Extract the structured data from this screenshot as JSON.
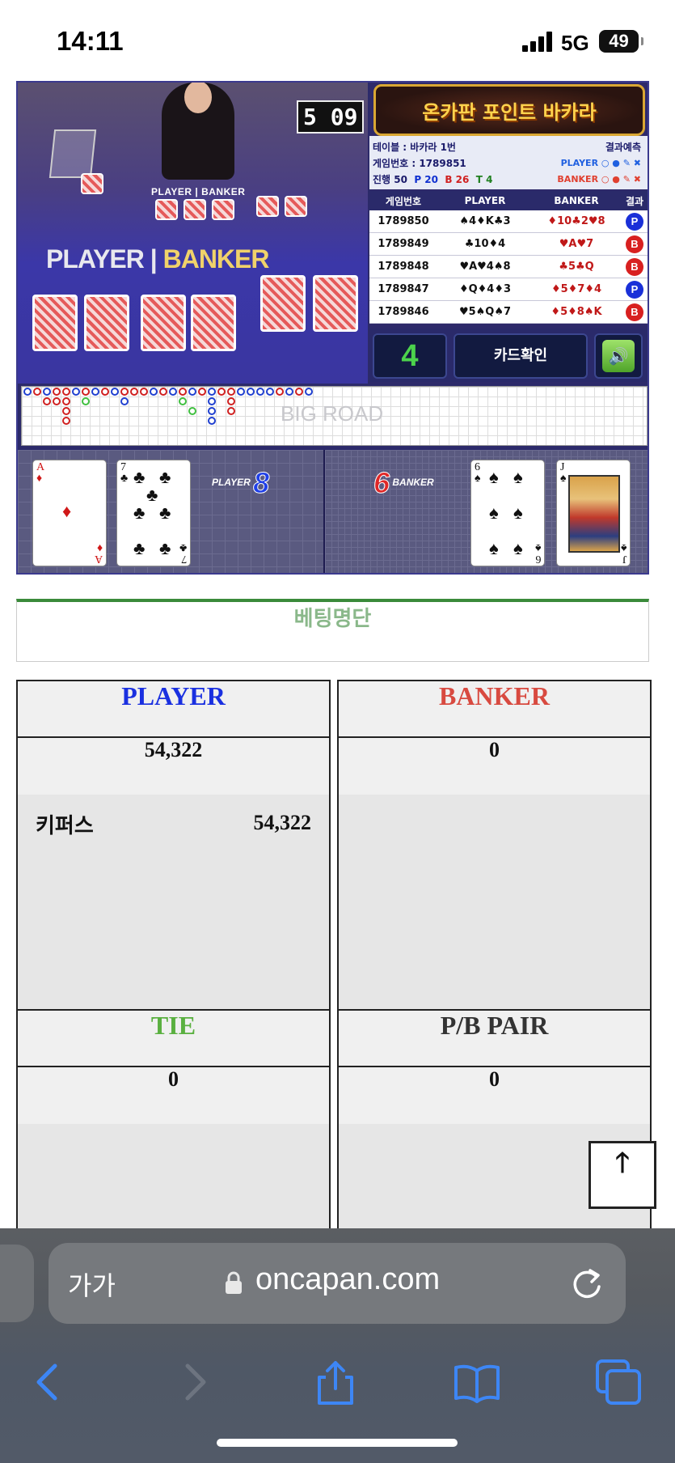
{
  "status": {
    "time": "14:11",
    "network": "5G",
    "battery": "49"
  },
  "game": {
    "timer": "5 09",
    "video_label_small": "PLAYER | BANKER",
    "video_label_player": "PLAYER",
    "video_label_banker": "BANKER",
    "banner": "온카판 포인트 바카라",
    "table_label": "테이블 : 바카라 1번",
    "prediction_label": "결과예측",
    "game_no_label": "게임번호 : 1789851",
    "pred_player": "PLAYER",
    "pred_banker": "BANKER",
    "progress_label": "진행 50",
    "progress_p": "P 20",
    "progress_b": "B 26",
    "progress_t": "T 4",
    "history_headers": [
      "게임번호",
      "PLAYER",
      "BANKER",
      "결과"
    ],
    "history": [
      {
        "no": "1789850",
        "player": "♠4♦K♣3",
        "banker": "♦10♣2♥8",
        "result": "P"
      },
      {
        "no": "1789849",
        "player": "♣10♦4",
        "banker": "♥A♥7",
        "result": "B"
      },
      {
        "no": "1789848",
        "player": "♥A♥4♠8",
        "banker": "♣5♣Q",
        "result": "B"
      },
      {
        "no": "1789847",
        "player": "♦Q♦4♦3",
        "banker": "♦5♦7♦4",
        "result": "P"
      },
      {
        "no": "1789846",
        "player": "♥5♠Q♠7",
        "banker": "♦5♦8♠K",
        "result": "B"
      }
    ],
    "counter": "4",
    "card_check": "카드확인",
    "big_road": "BIG ROAD",
    "player_score_label": "PLAYER",
    "player_score": "8",
    "banker_score_label": "BANKER",
    "banker_score": "6",
    "player_cards": [
      {
        "rank": "A",
        "suit": "♦"
      },
      {
        "rank": "7",
        "suit": "♣"
      }
    ],
    "banker_cards": [
      {
        "rank": "6",
        "suit": "♠"
      },
      {
        "rank": "J",
        "suit": "♠"
      }
    ]
  },
  "betting": {
    "tab_title": "베팅명단",
    "player": {
      "title": "PLAYER",
      "total": "54,322",
      "entries": [
        {
          "name": "키퍼스",
          "amount": "54,322"
        }
      ]
    },
    "banker": {
      "title": "BANKER",
      "total": "0"
    },
    "tie": {
      "title": "TIE",
      "total": "0"
    },
    "pair": {
      "title": "P/B PAIR",
      "total": "0"
    }
  },
  "browser": {
    "text_size": "가가",
    "domain": "oncapan.com"
  },
  "colors": {
    "player": "#1a30e0",
    "banker": "#d84a40",
    "tie": "#5ab040",
    "accent": "#3a8a3a"
  },
  "icons": [
    "signal-icon",
    "battery-icon",
    "sound-icon",
    "arrow-up-icon",
    "lock-icon",
    "reload-icon",
    "back-icon",
    "forward-icon",
    "share-icon",
    "bookmarks-icon",
    "tabs-icon"
  ]
}
